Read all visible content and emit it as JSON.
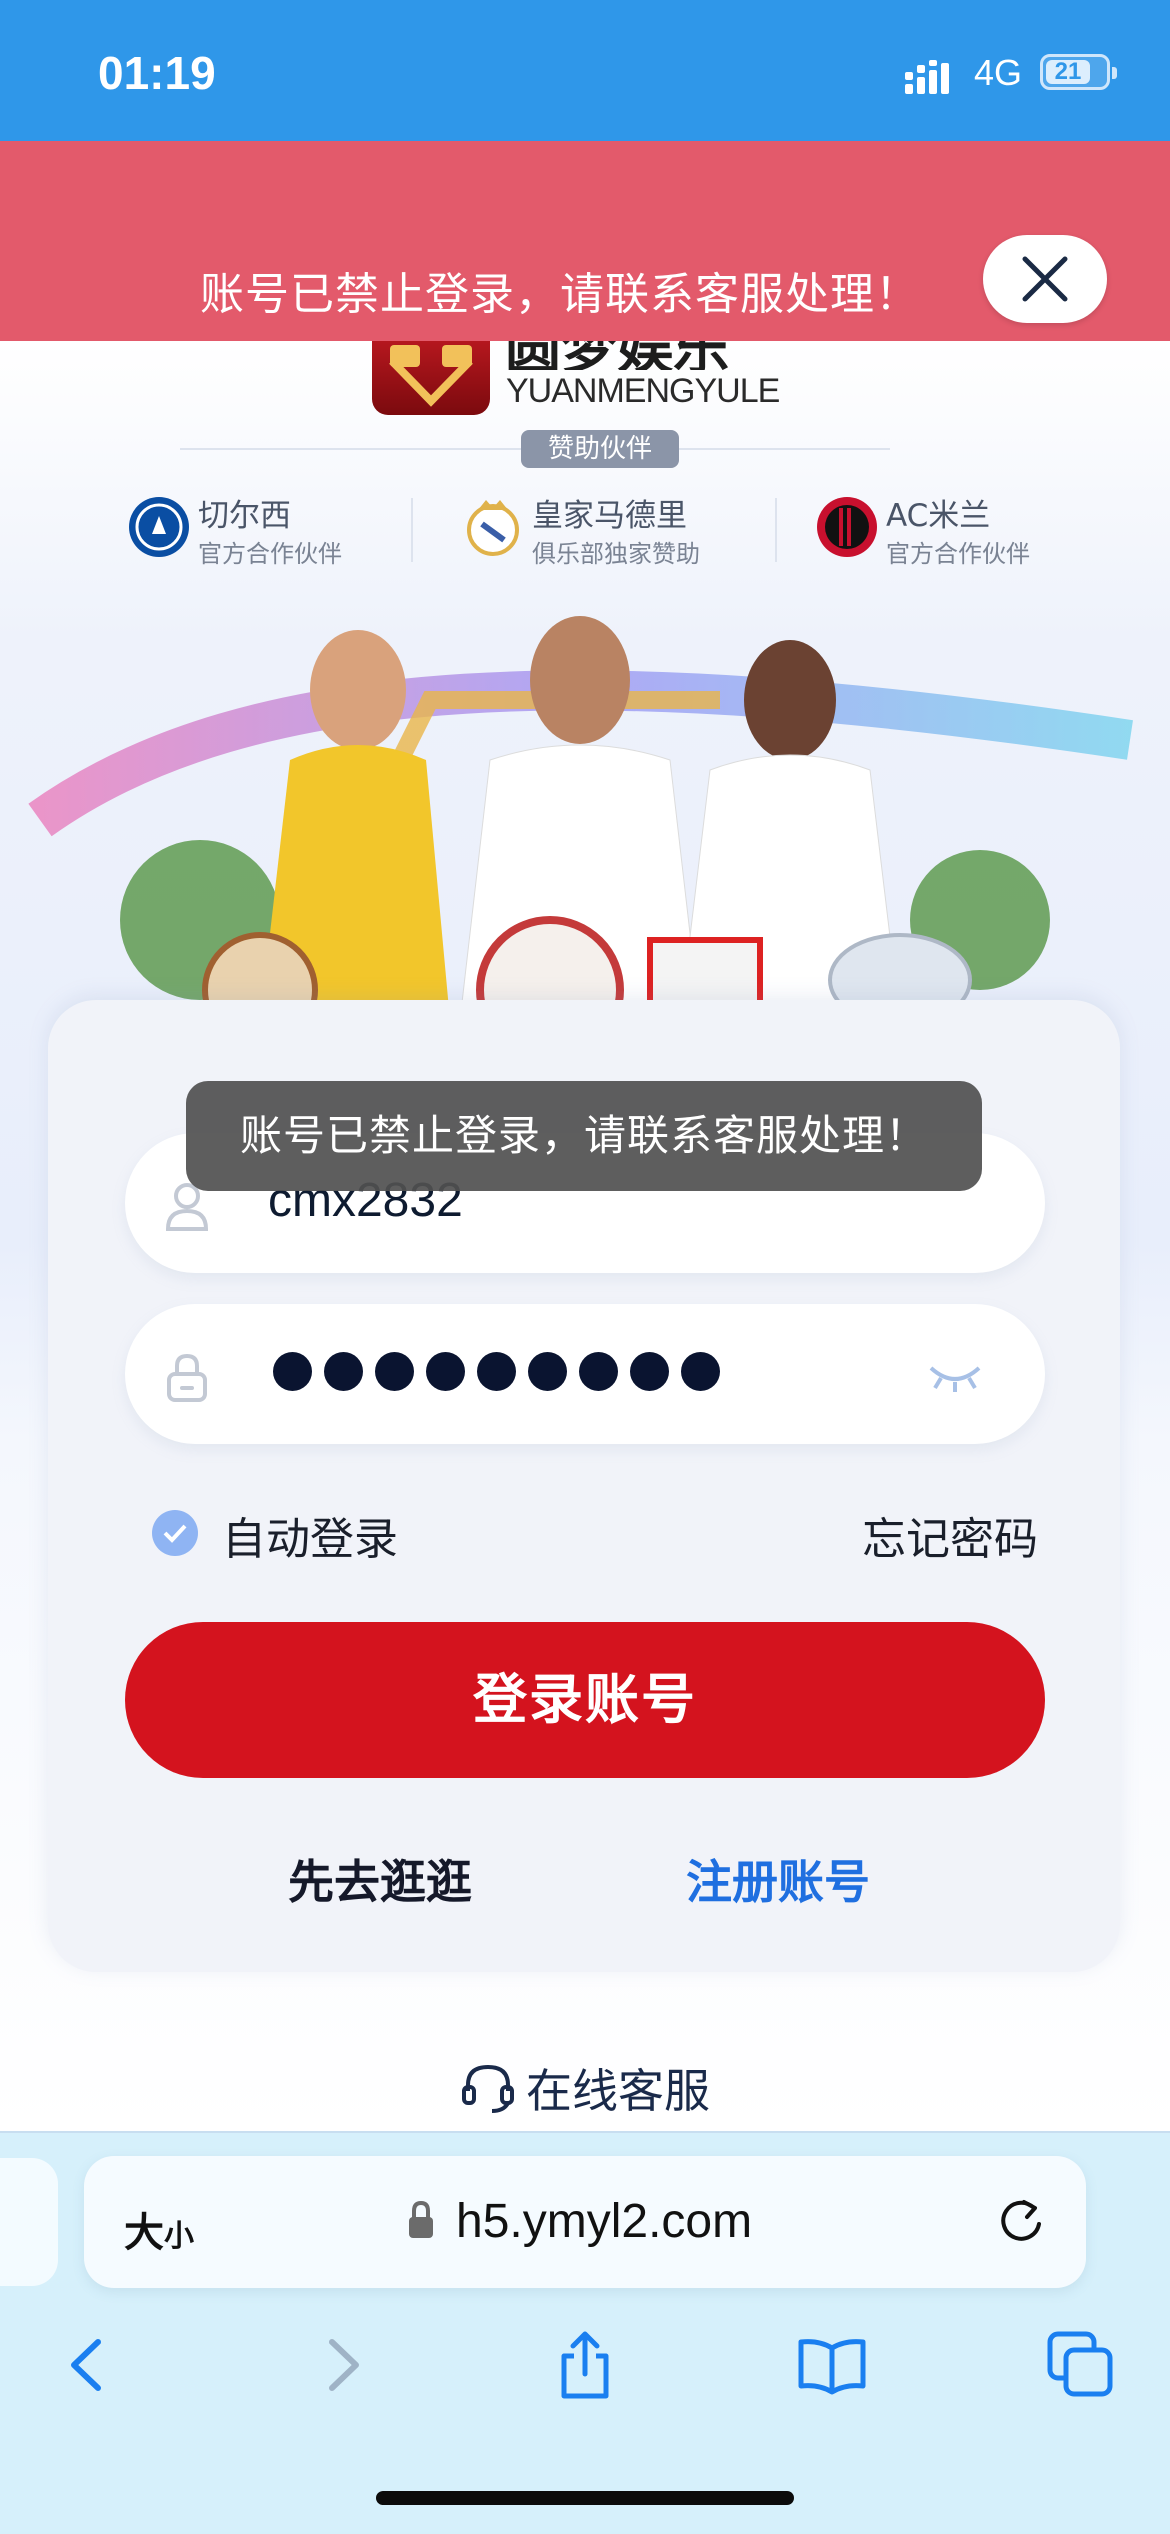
{
  "status_bar": {
    "time": "01:19",
    "network": "4G",
    "battery": "21"
  },
  "banner": {
    "message": "账号已禁止登录，请联系客服处理！"
  },
  "brand": {
    "name_cn": "圆梦娱乐",
    "name_en": "YUANMENGYULE",
    "sponsor_label": "赞助伙伴"
  },
  "partners": [
    {
      "name": "切尔西",
      "subtitle": "官方合作伙伴",
      "badge_color": "#0a4ea3"
    },
    {
      "name": "皇家马德里",
      "subtitle": "俱乐部独家赞助",
      "badge_color": "#e0b24a"
    },
    {
      "name": "AC米兰",
      "subtitle": "官方合作伙伴",
      "badge_color": "#c8102e"
    }
  ],
  "login": {
    "username": "cmx2832",
    "password_dots": 9,
    "auto_login_label": "自动登录",
    "forgot_label": "忘记密码",
    "submit_label": "登录账号",
    "browse_label": "先去逛逛",
    "register_label": "注册账号"
  },
  "toast": {
    "message": "账号已禁止登录，请联系客服处理！"
  },
  "service": {
    "label": "在线客服"
  },
  "browser": {
    "text_size_label": "大",
    "text_size_small": "小",
    "url": "h5.ymyl2.com"
  },
  "colors": {
    "accent_red": "#d4131e",
    "link_blue": "#1f6fe0",
    "banner": "#e35a6b",
    "status_bar": "#2f97e9"
  }
}
